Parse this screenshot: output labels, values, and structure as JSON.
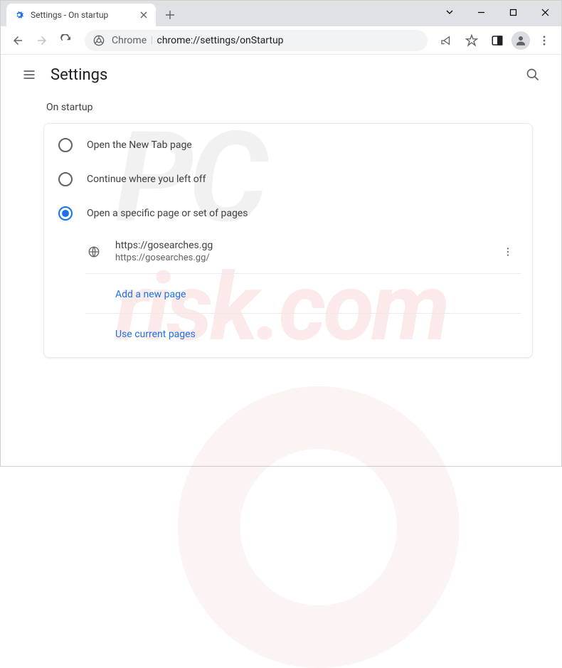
{
  "tab": {
    "title": "Settings - On startup"
  },
  "omnibox": {
    "scheme": "Chrome",
    "url": "chrome://settings/onStartup"
  },
  "header": {
    "title": "Settings"
  },
  "section": {
    "title": "On startup"
  },
  "radios": {
    "newtab": "Open the New Tab page",
    "continue": "Continue where you left off",
    "specific": "Open a specific page or set of pages"
  },
  "page": {
    "name": "https://gosearches.gg",
    "url": "https://gosearches.gg/"
  },
  "links": {
    "add": "Add a new page",
    "current": "Use current pages"
  }
}
